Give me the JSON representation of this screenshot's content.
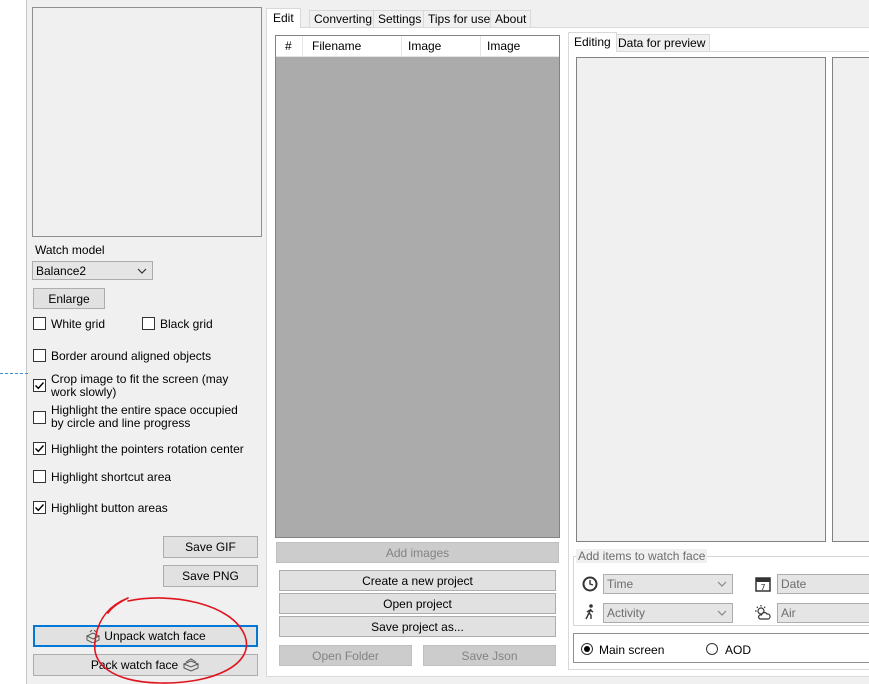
{
  "tabs": [
    {
      "label": "Edit"
    },
    {
      "label": "Converting"
    },
    {
      "label": "Settings"
    },
    {
      "label": "Tips for use"
    },
    {
      "label": "About"
    }
  ],
  "left_panel": {
    "watch_model_label": "Watch model",
    "watch_model_value": "Balance2",
    "enlarge": "Enlarge",
    "options": [
      {
        "label": "White grid",
        "checked": false
      },
      {
        "label": "Black grid",
        "checked": false
      },
      {
        "label": "Border around aligned objects",
        "checked": false
      },
      {
        "label": "Crop image to fit the screen (may work slowly)",
        "checked": true
      },
      {
        "label": "Highlight the entire space occupied by circle and line progress",
        "checked": false
      },
      {
        "label": "Highlight the pointers rotation center",
        "checked": true
      },
      {
        "label": "Highlight shortcut area",
        "checked": false
      },
      {
        "label": "Highlight button areas",
        "checked": true
      }
    ],
    "save_gif": "Save GIF",
    "save_png": "Save PNG",
    "unpack": "Unpack watch face",
    "pack": "Pack watch face"
  },
  "images_table": {
    "columns": [
      "#",
      "Filename",
      "Image",
      "Image"
    ],
    "rows": []
  },
  "middle_buttons": {
    "add_images": "Add images",
    "create_project": "Create a new project",
    "open_project": "Open project",
    "save_project_as": "Save project as...",
    "open_folder": "Open Folder",
    "save_json": "Save Json"
  },
  "right_tabs": [
    {
      "label": "Editing"
    },
    {
      "label": "Data for preview"
    }
  ],
  "add_items": {
    "legend": "Add items to watch face",
    "combo1": {
      "value": "Time",
      "icon": "clock-icon"
    },
    "combo2": {
      "value": "Date",
      "icon": "calendar-icon"
    },
    "combo3": {
      "value": "Activity",
      "icon": "walking-icon"
    },
    "combo4": {
      "value": "Air",
      "icon": "weather-icon"
    }
  },
  "screen_mode": {
    "main_screen": "Main screen",
    "aod": "AOD",
    "selected": "Main screen"
  },
  "annotation": {
    "color": "#e0141e"
  }
}
